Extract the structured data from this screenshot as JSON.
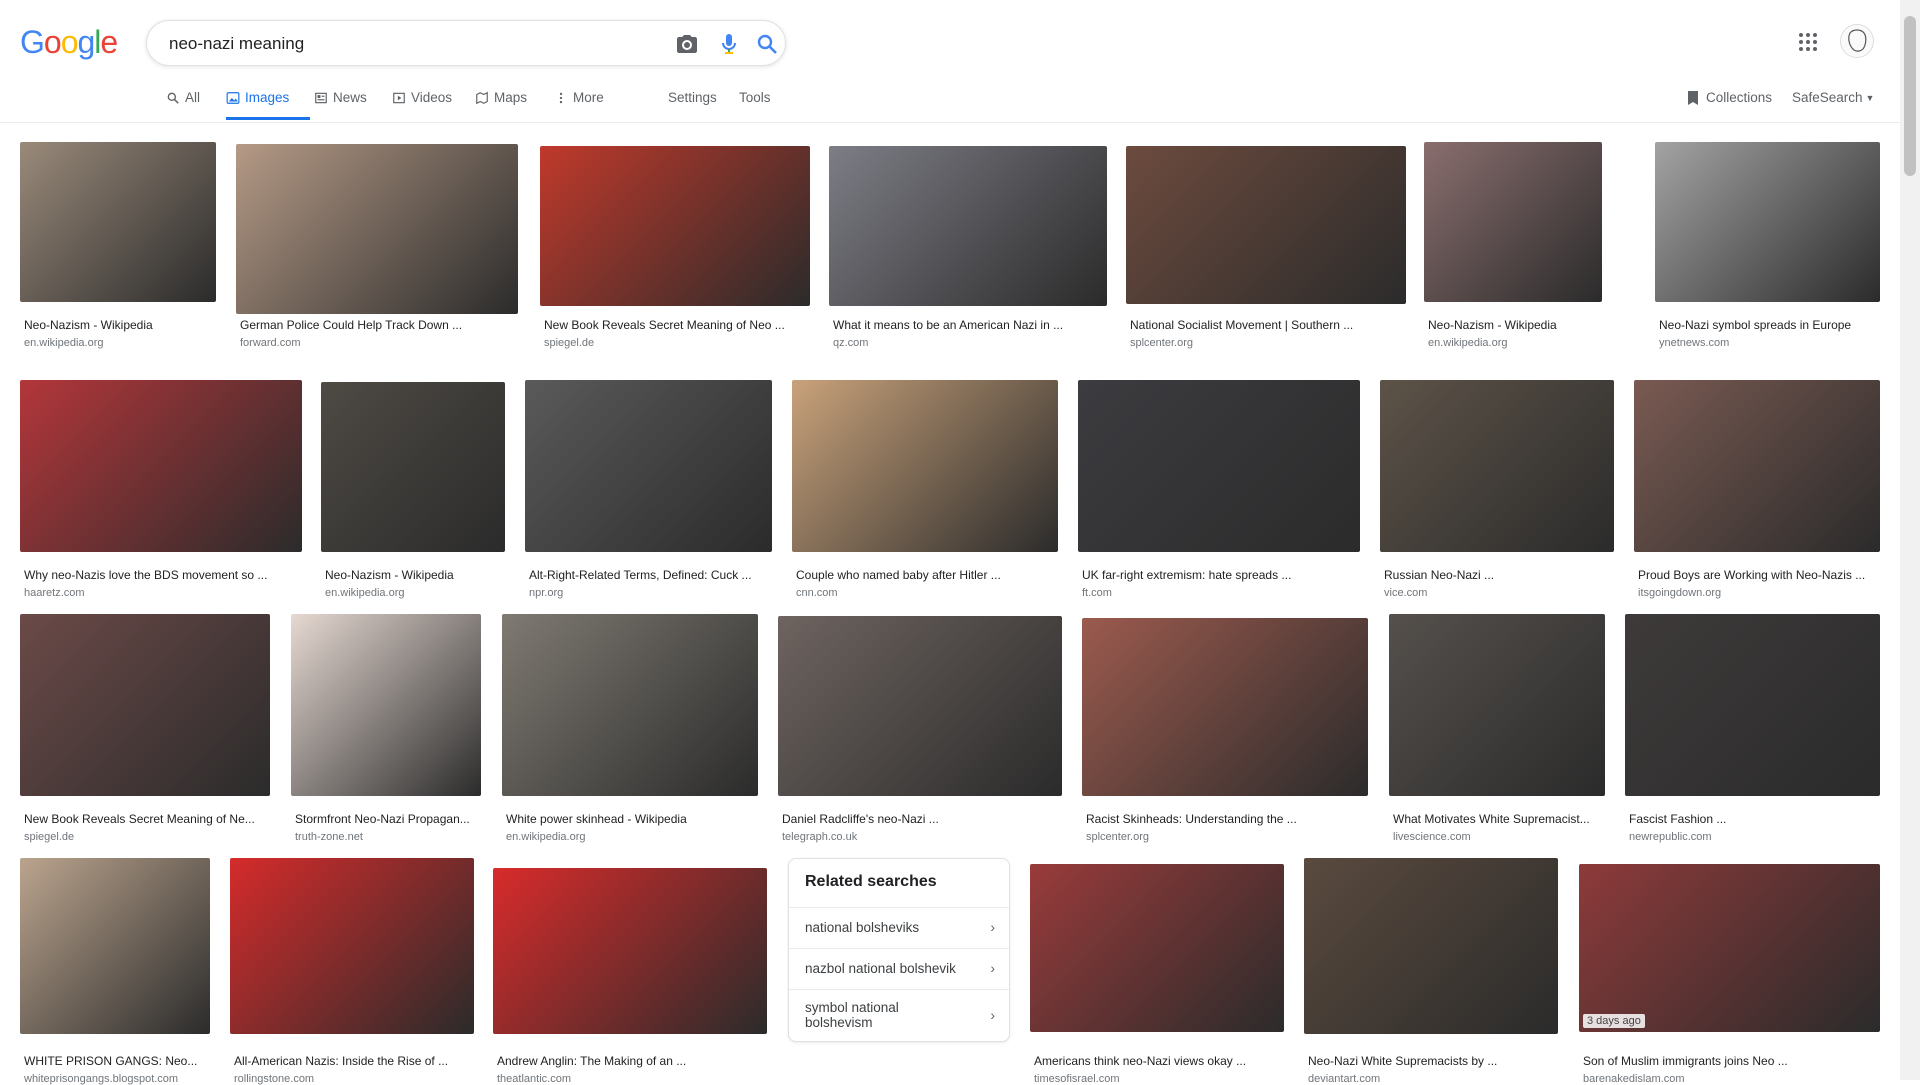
{
  "logo": {
    "letters": [
      "G",
      "o",
      "o",
      "g",
      "l",
      "e"
    ],
    "colors": [
      "#4285F4",
      "#EA4335",
      "#FBBC05",
      "#4285F4",
      "#34A853",
      "#EA4335"
    ]
  },
  "search": {
    "value": "neo-nazi meaning"
  },
  "tabs": [
    {
      "label": "All",
      "icon": "search-icon"
    },
    {
      "label": "Images",
      "icon": "image-icon"
    },
    {
      "label": "News",
      "icon": "news-icon"
    },
    {
      "label": "Videos",
      "icon": "video-icon"
    },
    {
      "label": "Maps",
      "icon": "map-icon"
    },
    {
      "label": "More",
      "icon": "more-vertical-icon"
    }
  ],
  "tools": {
    "settings": "Settings",
    "tools": "Tools",
    "collections": "Collections",
    "safesearch": "SafeSearch"
  },
  "results": [
    {
      "title": "Neo-Nazism - Wikipedia",
      "source": "en.wikipedia.org",
      "color": "#9a8a7a"
    },
    {
      "title": "German Police Could Help Track Down ...",
      "source": "forward.com",
      "color": "#b59a86"
    },
    {
      "title": "New Book Reveals Secret Meaning of Neo ...",
      "source": "spiegel.de",
      "color": "#c0392b"
    },
    {
      "title": "What it means to be an American Nazi in ...",
      "source": "qz.com",
      "color": "#7d7d86"
    },
    {
      "title": "National Socialist Movement | Southern ...",
      "source": "splcenter.org",
      "color": "#6d4b3e"
    },
    {
      "title": "Neo-Nazism - Wikipedia",
      "source": "en.wikipedia.org",
      "color": "#8a6e6e"
    },
    {
      "title": "Neo-Nazi symbol spreads in Europe",
      "source": "ynetnews.com",
      "color": "#a3a3a3"
    },
    {
      "title": "Why neo-Nazis love the BDS movement so ...",
      "source": "haaretz.com",
      "color": "#b3363a"
    },
    {
      "title": "Neo-Nazism - Wikipedia",
      "source": "en.wikipedia.org",
      "color": "#4e4a44"
    },
    {
      "title": "Alt-Right-Related Terms, Defined: Cuck ...",
      "source": "npr.org",
      "color": "#5a5a5a"
    },
    {
      "title": "Couple who named baby after Hitler ...",
      "source": "cnn.com",
      "color": "#c9a27a"
    },
    {
      "title": "UK far-right extremism: hate spreads ...",
      "source": "ft.com",
      "color": "#3c3c40"
    },
    {
      "title": "Russian Neo-Nazi ...",
      "source": "vice.com",
      "color": "#5d5348"
    },
    {
      "title": "Proud Boys are Working with Neo-Nazis ...",
      "source": "itsgoingdown.org",
      "color": "#7a5a52"
    },
    {
      "title": "New Book Reveals Secret Meaning of Ne...",
      "source": "spiegel.de",
      "color": "#6b4a48"
    },
    {
      "title": "Stormfront Neo-Nazi Propagan...",
      "source": "truth-zone.net",
      "color": "#e6d9d2"
    },
    {
      "title": "White power skinhead - Wikipedia",
      "source": "en.wikipedia.org",
      "color": "#7f7a72"
    },
    {
      "title": "Daniel Radcliffe's neo-Nazi ...",
      "source": "telegraph.co.uk",
      "color": "#6e6460"
    },
    {
      "title": "Racist Skinheads: Understanding the ...",
      "source": "splcenter.org",
      "color": "#9c5a4e"
    },
    {
      "title": "What Motivates White Supremacist...",
      "source": "livescience.com",
      "color": "#55504c"
    },
    {
      "title": "Fascist Fashion ...",
      "source": "newrepublic.com",
      "color": "#3e3a3a"
    },
    {
      "title": "WHITE PRISON GANGS: Neo...",
      "source": "whiteprisongangs.blogspot.com",
      "color": "#bba48e"
    },
    {
      "title": "All-American Nazis: Inside the Rise of ...",
      "source": "rollingstone.com",
      "color": "#d62b2b"
    },
    {
      "title": "Andrew Anglin: The Making of an ...",
      "source": "theatlantic.com",
      "color": "#d92b2b"
    },
    {
      "title": "Americans think neo-Nazi views okay ...",
      "source": "timesofisrael.com",
      "color": "#9a3b3b"
    },
    {
      "title": "Neo-Nazi White Supremacists by ...",
      "source": "deviantart.com",
      "color": "#5a4a3e"
    },
    {
      "title": "Son of Muslim immigrants joins Neo ...",
      "source": "barenakedislam.com",
      "color": "#8e3a3a",
      "badge": "3 days ago"
    }
  ],
  "related": {
    "heading": "Related searches",
    "items": [
      "national bolsheviks",
      "nazbol national bolshevik",
      "symbol national bolshevism"
    ]
  }
}
